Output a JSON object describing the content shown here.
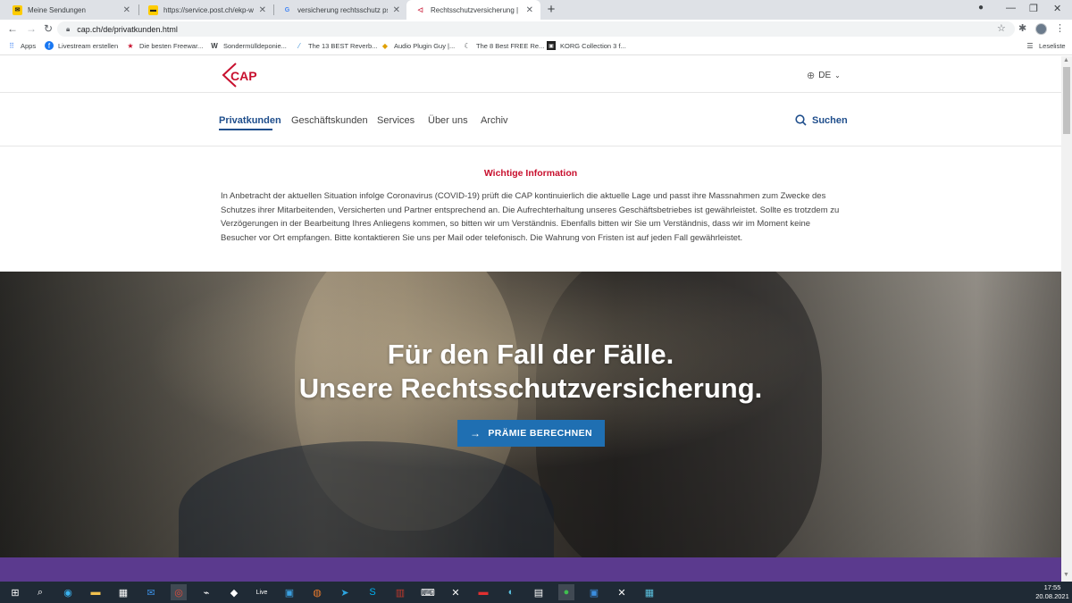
{
  "browser": {
    "tabs": [
      {
        "title": "Meine Sendungen",
        "favicon": "post-favicon",
        "color": "#ffcc00",
        "active": false
      },
      {
        "title": "https://service.post.ch/ekp-web/",
        "favicon": "post-favicon",
        "color": "#ffcc00",
        "active": false
      },
      {
        "title": "versicherung rechtsschutz psych",
        "favicon": "google-favicon",
        "color": "#4285f4",
        "active": false
      },
      {
        "title": "Rechtsschutzversicherung | Über",
        "favicon": "cap-favicon",
        "color": "#c8102e",
        "active": true
      }
    ],
    "address": "cap.ch/de/privatkunden.html",
    "bookmarks": [
      {
        "label": "Apps",
        "icon": "apps-grid-icon"
      },
      {
        "label": "Livestream erstellen",
        "icon": "facebook-icon"
      },
      {
        "label": "Die besten Freewar...",
        "icon": "star-icon"
      },
      {
        "label": "Sondermülldeponie...",
        "icon": "w-icon"
      },
      {
        "label": "The 13 BEST Reverb...",
        "icon": "slash-icon"
      },
      {
        "label": "Audio Plugin Guy |...",
        "icon": "audio-icon"
      },
      {
        "label": "The 8 Best FREE Re...",
        "icon": "moon-icon"
      },
      {
        "label": "KORG Collection 3 f...",
        "icon": "korg-icon"
      }
    ],
    "reading_list": "Leseliste"
  },
  "header": {
    "logo": "CAP",
    "language": "DE"
  },
  "nav": {
    "items": [
      "Privatkunden",
      "Geschäftskunden",
      "Services",
      "Über uns",
      "Archiv"
    ],
    "active": "Privatkunden",
    "search_label": "Suchen"
  },
  "info": {
    "title": "Wichtige Information",
    "text": "In Anbetracht der aktuellen Situation infolge Coronavirus (COVID-19) prüft die CAP kontinuierlich die aktuelle Lage und passt ihre Massnahmen zum Zwecke des Schutzes ihrer Mitarbeitenden, Versicherten und Partner entsprechend an. Die Aufrechterhaltung unseres Geschäftsbetriebes ist gewährleistet. Sollte es trotzdem zu Verzögerungen in der Bearbeitung Ihres Anliegens kommen, so bitten wir um Verständnis. Ebenfalls bitten wir Sie um Verständnis, dass wir im Moment keine Besucher vor Ort empfangen. Bitte kontaktieren Sie uns per Mail oder telefonisch. Die Wahrung von Fristen ist auf jeden Fall gewährleistet."
  },
  "hero": {
    "title_line1": "Für den Fall der Fälle.",
    "title_line2": "Unsere Rechtsschutzversicherung.",
    "cta": "PRÄMIE BERECHNEN"
  },
  "colors": {
    "brand_red": "#c8102e",
    "brand_blue": "#1f4e8c",
    "button_blue": "#1f6fb2",
    "band_purple": "#5b3a8e"
  },
  "taskbar": {
    "time": "17:55",
    "date": "20.08.2021"
  }
}
